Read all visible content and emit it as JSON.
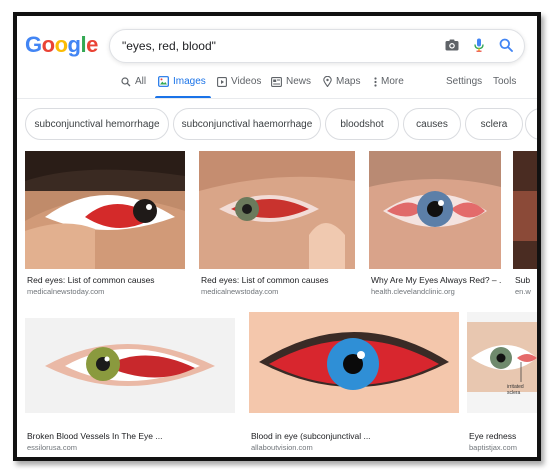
{
  "logo": [
    "G",
    "o",
    "o",
    "g",
    "l",
    "e"
  ],
  "search": {
    "query": "\"eyes, red, blood\""
  },
  "icons": {
    "camera": "camera-icon",
    "mic": "mic-icon",
    "search": "search-icon"
  },
  "tabs": [
    {
      "label": "All",
      "icon": "search-icon"
    },
    {
      "label": "Images",
      "icon": "image-icon",
      "active": true
    },
    {
      "label": "Videos",
      "icon": "video-icon"
    },
    {
      "label": "News",
      "icon": "news-icon"
    },
    {
      "label": "Maps",
      "icon": "map-pin-icon"
    },
    {
      "label": "More",
      "icon": "more-icon"
    }
  ],
  "tools": {
    "settings": "Settings",
    "tools": "Tools"
  },
  "chips": [
    "subconjunctival hemorrhage",
    "subconjunctival haemorrhage",
    "bloodshot",
    "causes",
    "sclera"
  ],
  "results": [
    {
      "title": "Red eyes: List of common causes",
      "source": "medicalnewstoday.com"
    },
    {
      "title": "Red eyes: List of common causes",
      "source": "medicalnewstoday.com"
    },
    {
      "title": "Why Are My Eyes Always Red? – ...",
      "source": "health.clevelandclinic.org"
    },
    {
      "title": "Sub",
      "source": "en.w"
    },
    {
      "title": "Broken Blood Vessels In The Eye ...",
      "source": "essilorusa.com"
    },
    {
      "title": "Blood in eye (subconjunctival ...",
      "source": "allaboutvision.com"
    },
    {
      "title": "Eye redness",
      "source": "baptistjax.com"
    }
  ],
  "diagram_labels": {
    "a": "irritated",
    "b": "sclera"
  },
  "colors": {
    "accent": "#1a73e8",
    "muted": "#5f6368"
  }
}
